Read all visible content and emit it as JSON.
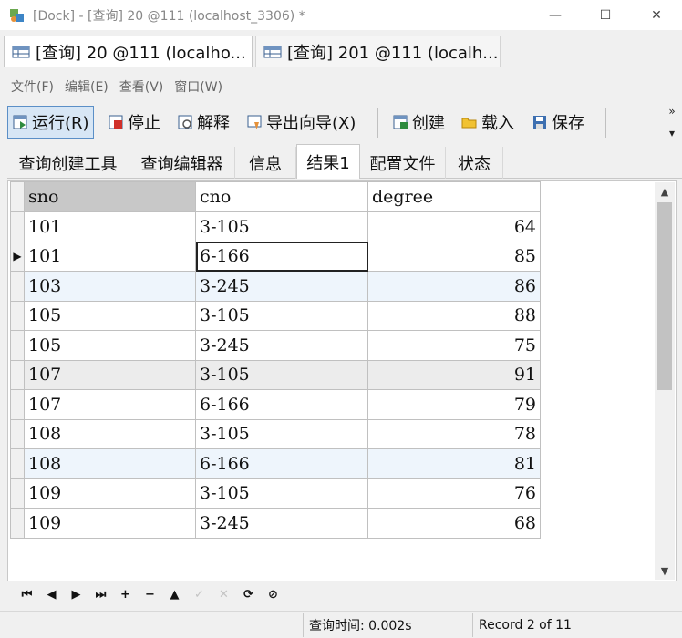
{
  "window": {
    "title": "[Dock] - [查询] 20 @111 (localhost_3306) *",
    "minimize": "—",
    "maximize": "☐",
    "close": "✕"
  },
  "doc_tabs": [
    {
      "label": "[查询] 20 @111 (localho..."
    },
    {
      "label": "[查询] 201 @111 (localh..."
    }
  ],
  "menu": [
    "文件(F)",
    "编辑(E)",
    "查看(V)",
    "窗口(W)"
  ],
  "toolbar": {
    "run": "运行(R)",
    "stop": "停止",
    "explain": "解释",
    "export": "导出向导(X)",
    "create": "创建",
    "load": "载入",
    "save": "保存",
    "overflow": "»"
  },
  "sub_tabs": [
    "查询创建工具",
    "查询编辑器",
    "信息",
    "结果1",
    "配置文件",
    "状态"
  ],
  "grid": {
    "columns": [
      "sno",
      "cno",
      "degree"
    ],
    "rows": [
      [
        "101",
        "3-105",
        "64"
      ],
      [
        "101",
        "6-166",
        "85"
      ],
      [
        "103",
        "3-245",
        "86"
      ],
      [
        "105",
        "3-105",
        "88"
      ],
      [
        "105",
        "3-245",
        "75"
      ],
      [
        "107",
        "3-105",
        "91"
      ],
      [
        "107",
        "6-166",
        "79"
      ],
      [
        "108",
        "3-105",
        "78"
      ],
      [
        "108",
        "6-166",
        "81"
      ],
      [
        "109",
        "3-105",
        "76"
      ],
      [
        "109",
        "3-245",
        "68"
      ]
    ],
    "current_row_marker": "▶"
  },
  "navigator": {
    "first": "⏮",
    "prev": "◀",
    "next": "▶",
    "last": "⏭",
    "add": "+",
    "delete": "−",
    "post": "▲",
    "apply": "✓",
    "cancel": "✕",
    "refresh": "⟳",
    "stop": "⊘"
  },
  "status": {
    "query_time": "查询时间: 0.002s",
    "record": "Record 2 of 11"
  },
  "colors": {
    "selected_band": "#eef5fc",
    "sorted_header": "#c8c8c8",
    "pressed_button": "#d7e6f5"
  }
}
